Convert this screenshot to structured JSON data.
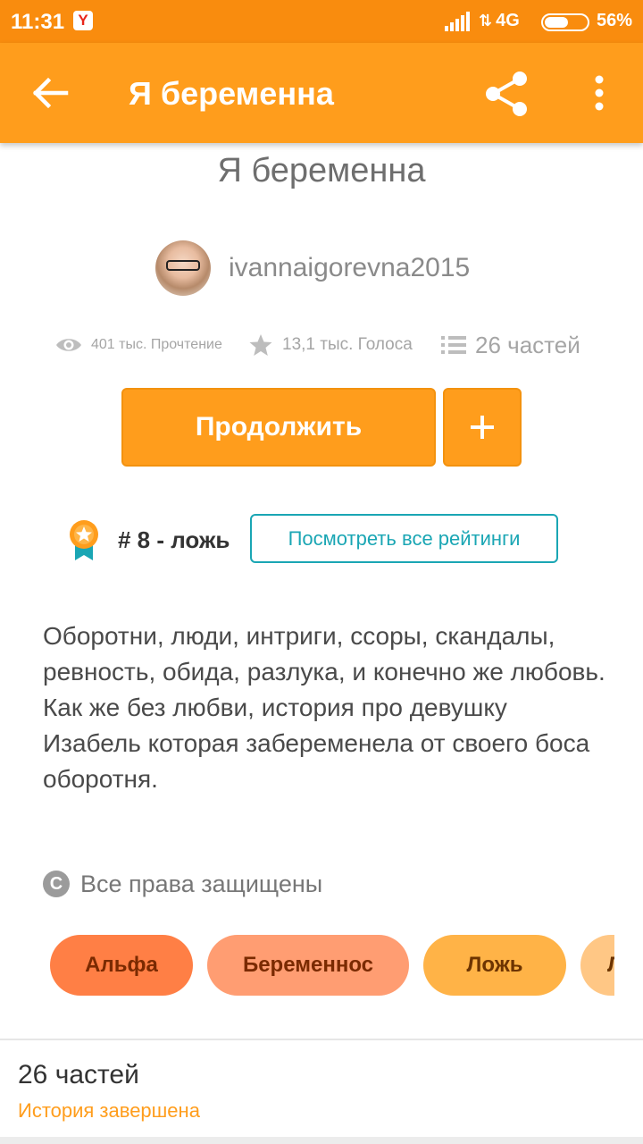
{
  "status_bar": {
    "time": "11:31",
    "yandex_badge": "Y",
    "network": "4G",
    "battery": "56%",
    "battery_level": 0.56
  },
  "app_bar": {
    "title": "Я беременна",
    "back_icon": "arrow-left-icon",
    "share_icon": "share-icon",
    "menu_icon": "more-vertical-icon"
  },
  "story": {
    "title": "Я беременна",
    "author": "ivannaigorevna2015",
    "stats": {
      "reads": "401 тыс. Прочтение",
      "votes": "13,1 тыс. Голоса",
      "parts": "26 частей"
    },
    "continue_label": "Продолжить",
    "add_label": "+",
    "rank": "# 8 - ложь",
    "rankings_button": "Посмотреть все рейтинги",
    "description": [
      "Оборотни, люди, интриги, ссоры, скандалы, ревность, обида, разлука, и конечно же любовь.",
      "Как же без любви, история про девушку Изабель которая забеременела от своего боса оборотня."
    ],
    "copyright_symbol": "C",
    "copyright": "Все права защищены",
    "tags": [
      "Альфа",
      "Беременнос",
      "Ложь",
      "Л"
    ]
  },
  "footer": {
    "parts_count": "26 частей",
    "status": "История завершена"
  },
  "colors": {
    "status_bar": "#f98c0e",
    "app_bar": "#ff9d1c",
    "accent": "#ff9d1c",
    "teal": "#1aa6b4"
  }
}
